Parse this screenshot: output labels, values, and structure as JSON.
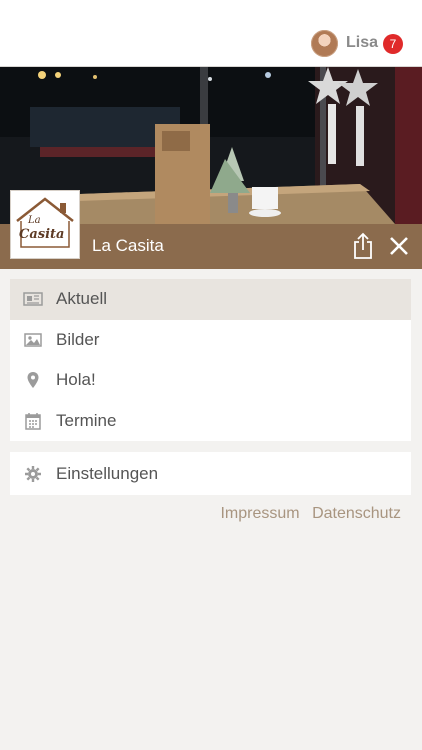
{
  "user": {
    "name": "Lisa",
    "notification_count": "7"
  },
  "brand": {
    "title": "La Casita",
    "logo_text_line1": "La",
    "logo_text_line2": "Casita",
    "bar_color": "#8b6b4d"
  },
  "menu": {
    "items": [
      {
        "label": "Aktuell",
        "icon": "newspaper-icon",
        "active": true
      },
      {
        "label": "Bilder",
        "icon": "image-icon",
        "active": false
      },
      {
        "label": "Hola!",
        "icon": "location-pin-icon",
        "active": false
      },
      {
        "label": "Termine",
        "icon": "calendar-icon",
        "active": false
      }
    ]
  },
  "settings": {
    "label": "Einstellungen",
    "icon": "gear-icon"
  },
  "footer": {
    "impressum": "Impressum",
    "datenschutz": "Datenschutz"
  },
  "colors": {
    "accent": "#8b6b4d",
    "badge": "#e02a2a",
    "active_item": "#e8e4df",
    "link": "#a89580"
  }
}
